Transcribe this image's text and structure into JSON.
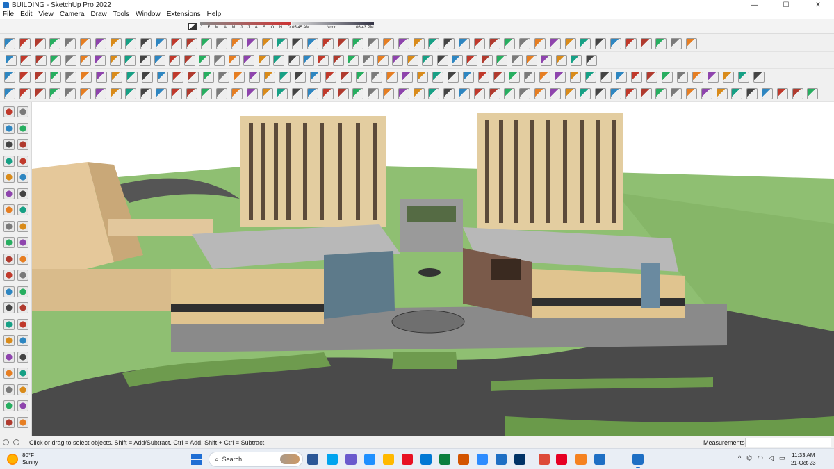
{
  "window": {
    "title": "BUILDING - SketchUp Pro 2022",
    "controls": {
      "minimize": "—",
      "maximize": "☐",
      "close": "✕"
    }
  },
  "menu": {
    "items": [
      "File",
      "Edit",
      "View",
      "Camera",
      "Draw",
      "Tools",
      "Window",
      "Extensions",
      "Help"
    ]
  },
  "shadows": {
    "months": [
      "J",
      "F",
      "M",
      "A",
      "M",
      "J",
      "J",
      "A",
      "S",
      "O",
      "N",
      "D"
    ],
    "time_start": "05:45 AM",
    "time_noon": "Noon",
    "time_end": "06:43 PM"
  },
  "status": {
    "hint": "Click or drag to select objects. Shift = Add/Subtract. Ctrl = Add. Shift + Ctrl = Subtract.",
    "measurements_label": "Measurements"
  },
  "taskbar": {
    "weather_temp": "80°F",
    "weather_desc": "Sunny",
    "search_placeholder": "Search",
    "tray_caret": "^",
    "time": "11:33 AM",
    "date": "21-Oct-23"
  },
  "colors": {
    "accent": "#1f6ed4",
    "sky": "#ffffff",
    "ground": "#8fbf72",
    "road": "#4a4a4a",
    "tower": "#e3cda0"
  }
}
